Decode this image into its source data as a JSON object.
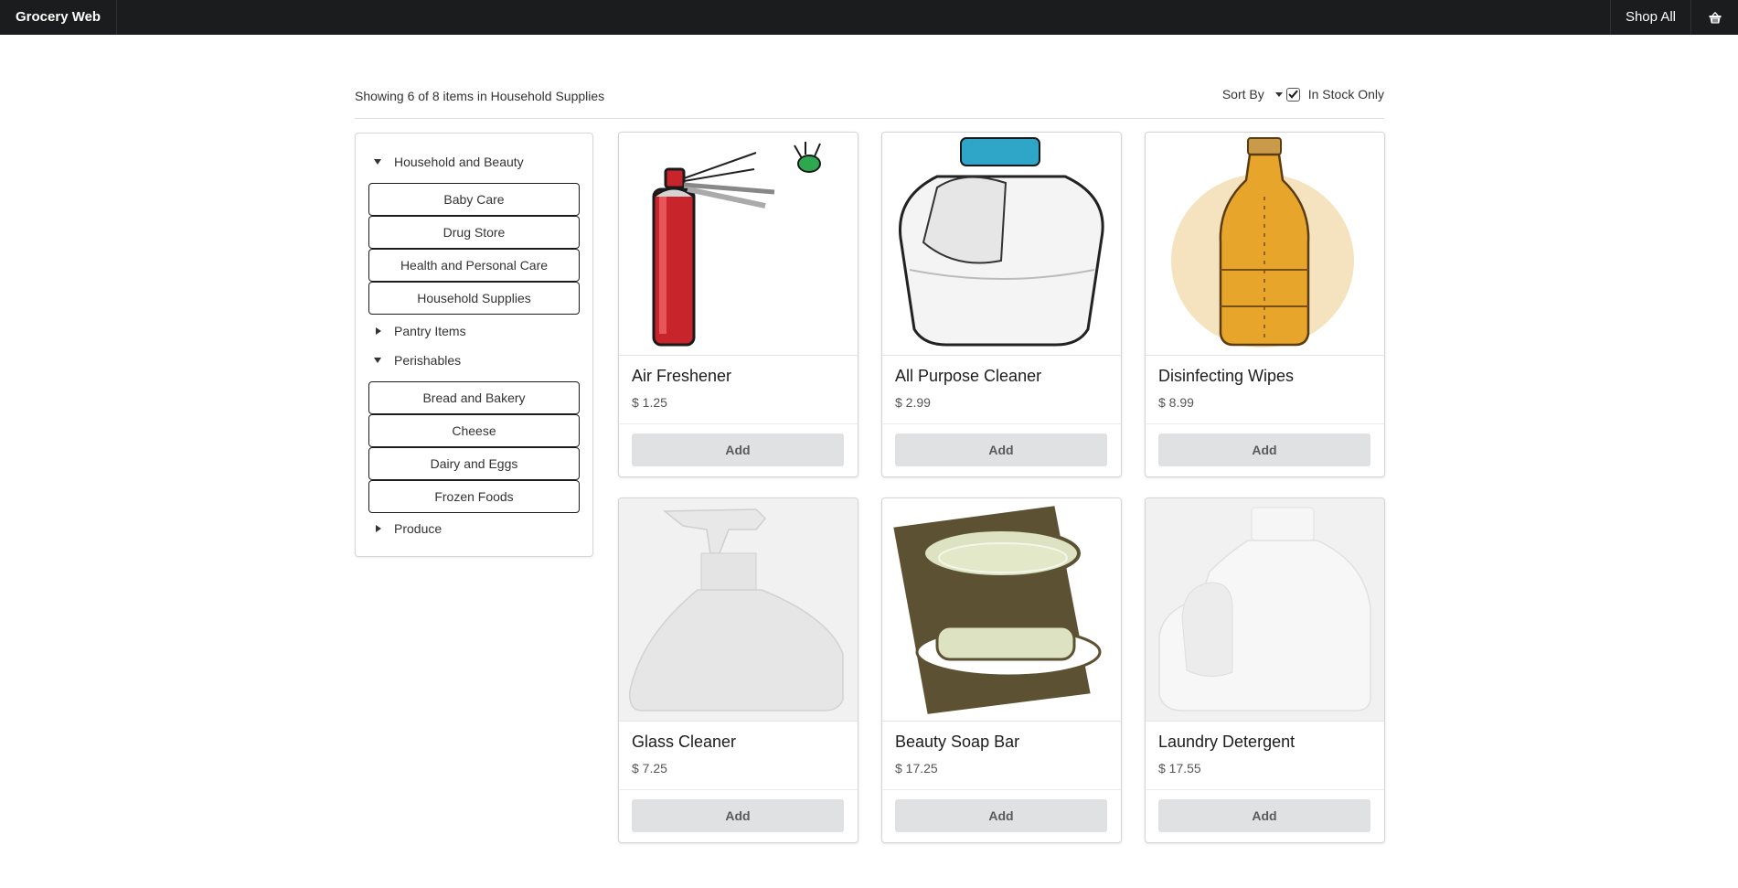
{
  "app": {
    "brand": "Grocery Web",
    "shop_all": "Shop All",
    "cart_icon": "shopping-basket-icon"
  },
  "results": {
    "summary": "Showing 6 of 8 items in Household Supplies",
    "sort_label": "Sort By",
    "in_stock_label": "In Stock Only",
    "in_stock_checked": true
  },
  "sidebar": {
    "groups": [
      {
        "label": "Household and Beauty",
        "expanded": true,
        "items": [
          "Baby Care",
          "Drug Store",
          "Health and Personal Care",
          "Household Supplies"
        ]
      },
      {
        "label": "Pantry Items",
        "expanded": false,
        "items": []
      },
      {
        "label": "Perishables",
        "expanded": true,
        "items": [
          "Bread and Bakery",
          "Cheese",
          "Dairy and Eggs",
          "Frozen Foods"
        ]
      },
      {
        "label": "Produce",
        "expanded": false,
        "items": []
      }
    ]
  },
  "products": [
    {
      "name": "Air Freshener",
      "price": "$ 1.25",
      "add_label": "Add",
      "image": "aerosol-spray-can"
    },
    {
      "name": "All Purpose Cleaner",
      "price": "$ 2.99",
      "add_label": "Add",
      "image": "plastic-jug"
    },
    {
      "name": "Disinfecting Wipes",
      "price": "$ 8.99",
      "add_label": "Add",
      "image": "amber-bottle"
    },
    {
      "name": "Glass Cleaner",
      "price": "$ 7.25",
      "add_label": "Add",
      "image": "spray-bottle"
    },
    {
      "name": "Beauty Soap Bar",
      "price": "$ 17.25",
      "add_label": "Add",
      "image": "soap-bars"
    },
    {
      "name": "Laundry Detergent",
      "price": "$ 17.55",
      "add_label": "Add",
      "image": "detergent-jug"
    }
  ],
  "colors": {
    "topbar": "#1b1c1d",
    "add_button": "#e0e1e2"
  }
}
